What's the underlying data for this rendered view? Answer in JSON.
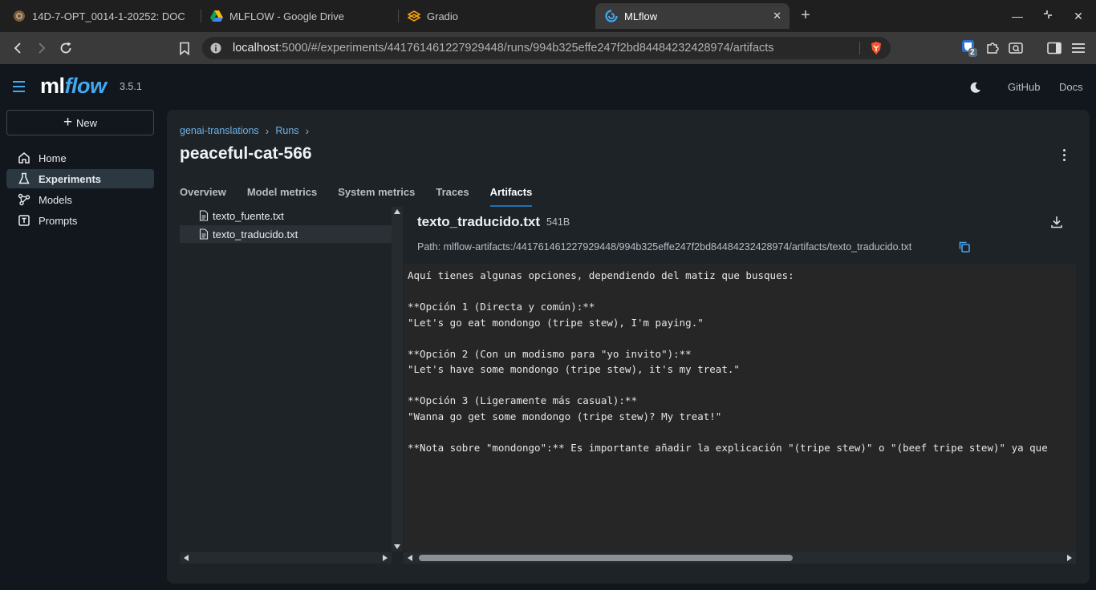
{
  "browser": {
    "tabs": [
      {
        "label": "14D-7-OPT_0014-1-20252: DOC",
        "active": false
      },
      {
        "label": "MLFLOW - Google Drive",
        "active": false
      },
      {
        "label": "Gradio",
        "active": false
      },
      {
        "label": "MLflow",
        "active": true
      }
    ],
    "url_host": "localhost",
    "url_rest": ":5000/#/experiments/441761461227929448/runs/994b325effe247f2bd84484232428974/artifacts",
    "extension_badge": "2"
  },
  "header": {
    "logo_ml": "ml",
    "logo_flow": "flow",
    "version": "3.5.1",
    "github_label": "GitHub",
    "docs_label": "Docs"
  },
  "sidebar": {
    "new_label": "New",
    "items": [
      {
        "label": "Home",
        "icon": "home-icon",
        "active": false
      },
      {
        "label": "Experiments",
        "icon": "beaker-icon",
        "active": true
      },
      {
        "label": "Models",
        "icon": "models-icon",
        "active": false
      },
      {
        "label": "Prompts",
        "icon": "prompt-icon",
        "active": false
      }
    ]
  },
  "run": {
    "breadcrumb": [
      "genai-translations",
      "Runs"
    ],
    "title": "peaceful-cat-566",
    "tabs": [
      "Overview",
      "Model metrics",
      "System metrics",
      "Traces",
      "Artifacts"
    ],
    "active_tab": "Artifacts"
  },
  "artifacts": {
    "files": [
      {
        "name": "texto_fuente.txt",
        "selected": false
      },
      {
        "name": "texto_traducido.txt",
        "selected": true
      }
    ],
    "viewer": {
      "file_name": "texto_traducido.txt",
      "size": "541B",
      "path": "Path: mlflow-artifacts:/441761461227929448/994b325effe247f2bd84484232428974/artifacts/texto_traducido.txt",
      "content": "Aquí tienes algunas opciones, dependiendo del matiz que busques:\n\n**Opción 1 (Directa y común):**\n\"Let's go eat mondongo (tripe stew), I'm paying.\"\n\n**Opción 2 (Con un modismo para \"yo invito\"):**\n\"Let's have some mondongo (tripe stew), it's my treat.\"\n\n**Opción 3 (Ligeramente más casual):**\n\"Wanna go get some mondongo (tripe stew)? My treat!\"\n\n**Nota sobre \"mondongo\":** Es importante añadir la explicación \"(tripe stew)\" o \"(beef tripe stew)\" ya que"
    }
  },
  "colors": {
    "accent": "#2272b4",
    "link": "#6fb3e7",
    "logo_flow": "#43a9f0",
    "background": "#11171c",
    "card": "#1e2328"
  }
}
